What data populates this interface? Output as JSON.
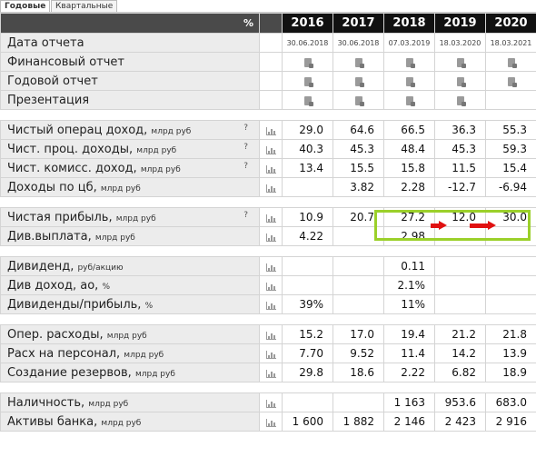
{
  "tabs": {
    "annual": "Годовые",
    "quarterly": "Квартальные"
  },
  "header": {
    "percent": "%",
    "years": [
      "2016",
      "2017",
      "2018",
      "2019",
      "2020"
    ]
  },
  "doc_rows": [
    {
      "label": "Дата отчета",
      "values": [
        "30.06.2018",
        "30.06.2018",
        "07.03.2019",
        "18.03.2020",
        "18.03.2021"
      ]
    },
    {
      "label": "Финансовый отчет",
      "docs": [
        true,
        true,
        true,
        true,
        true
      ]
    },
    {
      "label": "Годовой отчет",
      "docs": [
        true,
        true,
        true,
        true,
        true
      ]
    },
    {
      "label": "Презентация",
      "docs": [
        true,
        true,
        true,
        true,
        false
      ]
    }
  ],
  "groups": [
    [
      {
        "label": "Чистый операц доход",
        "unit": "млрд руб",
        "q": "?",
        "values": [
          "29.0",
          "64.6",
          "66.5",
          "36.3",
          "55.3"
        ]
      },
      {
        "label": "Чист. проц. доходы",
        "unit": "млрд руб",
        "q": "?",
        "values": [
          "40.3",
          "45.3",
          "48.4",
          "45.3",
          "59.3"
        ]
      },
      {
        "label": "Чист. комисс. доход",
        "unit": "млрд руб",
        "q": "?",
        "values": [
          "13.4",
          "15.5",
          "15.8",
          "11.5",
          "15.4"
        ]
      },
      {
        "label": "Доходы по цб",
        "unit": "млрд руб",
        "q": "",
        "values": [
          "",
          "3.82",
          "2.28",
          "-12.7",
          "-6.94"
        ]
      }
    ],
    [
      {
        "label": "Чистая прибыль",
        "unit": "млрд руб",
        "q": "?",
        "values": [
          "10.9",
          "20.7",
          "27.2",
          "12.0",
          "30.0"
        ]
      },
      {
        "label": "Див.выплата",
        "unit": "млрд руб",
        "q": "",
        "values": [
          "4.22",
          "",
          "2.98",
          "",
          ""
        ]
      }
    ],
    [
      {
        "label": "Дивиденд",
        "unit": "руб/акцию",
        "q": "",
        "values": [
          "",
          "",
          "0.11",
          "",
          ""
        ]
      },
      {
        "label": "Див доход, ао",
        "unit": "%",
        "q": "",
        "values": [
          "",
          "",
          "2.1%",
          "",
          ""
        ]
      },
      {
        "label": "Дивиденды/прибыль",
        "unit": "%",
        "q": "",
        "values": [
          "39%",
          "",
          "11%",
          "",
          ""
        ]
      }
    ],
    [
      {
        "label": "Опер. расходы",
        "unit": "млрд руб",
        "q": "",
        "values": [
          "15.2",
          "17.0",
          "19.4",
          "21.2",
          "21.8"
        ]
      },
      {
        "label": "Расх на персонал",
        "unit": "млрд руб",
        "q": "",
        "values": [
          "7.70",
          "9.52",
          "11.4",
          "14.2",
          "13.9"
        ]
      },
      {
        "label": "Создание резервов",
        "unit": "млрд руб",
        "q": "",
        "values": [
          "29.8",
          "18.6",
          "2.22",
          "6.82",
          "18.9"
        ]
      }
    ],
    [
      {
        "label": "Наличность",
        "unit": "млрд руб",
        "q": "",
        "values": [
          "",
          "",
          "1 163",
          "953.6",
          "683.0"
        ]
      },
      {
        "label": "Активы банка",
        "unit": "млрд руб",
        "q": "",
        "values": [
          "1 600",
          "1 882",
          "2 146",
          "2 423",
          "2 916"
        ]
      }
    ]
  ],
  "colors": {
    "highlight": "#9bd02a",
    "arrow": "#e01010",
    "header_bg": "#111111"
  }
}
